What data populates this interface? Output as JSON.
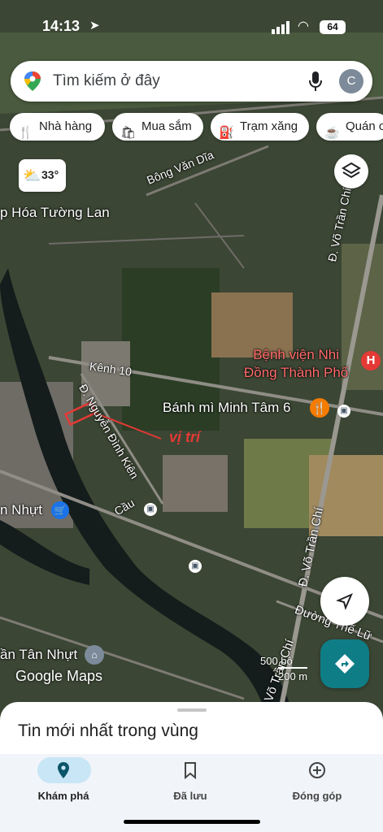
{
  "status": {
    "time": "14:13",
    "battery": "64"
  },
  "search": {
    "placeholder": "Tìm kiếm ở đây",
    "avatar_letter": "C"
  },
  "chips": [
    "Nhà hàng",
    "Mua sắm",
    "Trạm xăng",
    "Quán c"
  ],
  "weather": {
    "temp": "33°"
  },
  "map_labels": {
    "street_bong_van_dia": "Bông Văn Dĩa",
    "shop_tuong_lan": "p Hóa Tường Lan",
    "street_vo_tran_chi_top": "Đ. Võ Trần Chí",
    "kenh_10": "Kênh 10",
    "hospital": "Bệnh viện Nhi\nĐồng Thành Phố",
    "banh_mi": "Bánh mì Minh Tâm 6",
    "street_nguyen_dinh_kien": "Đ. Nguyễn Đình Kiên",
    "vi_tri": "vị trí",
    "nhut": "n Nhựt",
    "cau": "Cầu",
    "street_vo_tran_chi_mid": "Đ. Võ Trần Chí",
    "street_the_lu": "Đường Thế Lữ",
    "street_vo_tran_chi_bottom": "Võ Trần Chí",
    "tan_nhut": "ần Tân Nhựt"
  },
  "scale": {
    "imperial": "500 bộ",
    "metric": "200 m"
  },
  "attribution": "Google Maps",
  "sheet": {
    "title": "Tin mới nhất trong vùng"
  },
  "tabs": [
    {
      "label": "Khám phá",
      "icon": "explore-pin-icon",
      "active": true
    },
    {
      "label": "Đã lưu",
      "icon": "bookmark-icon",
      "active": false
    },
    {
      "label": "Đóng góp",
      "icon": "add-circle-icon",
      "active": false
    }
  ],
  "colors": {
    "accent": "#0f7d86",
    "hospital": "#e53935",
    "food": "#f57c00",
    "tab_active_pill": "#c8e6f5"
  }
}
